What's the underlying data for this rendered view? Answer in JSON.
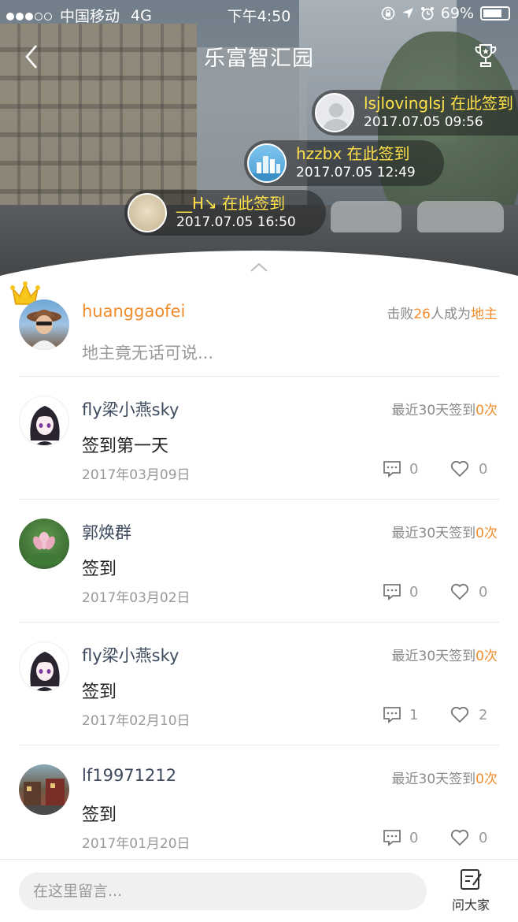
{
  "status_bar": {
    "carrier": "中国移动",
    "network": "4G",
    "time": "下午4:50",
    "battery": "69%"
  },
  "nav": {
    "title": "乐富智汇园"
  },
  "checkins": [
    {
      "who": "lsjlovinglsj 在此签到",
      "when": "2017.07.05  09:56"
    },
    {
      "who": "hzzbx 在此签到",
      "when": "2017.07.05  12:49"
    },
    {
      "who": "__H↘ 在此签到",
      "when": "2017.07.05  16:50"
    }
  ],
  "landlord": {
    "name": "huanggaofei",
    "beat_prefix": "击败",
    "beat_count": "26",
    "beat_mid": "人成为",
    "beat_title": "地主",
    "motto": "地主竟无话可说..."
  },
  "posts": [
    {
      "name": "fly梁小燕sky",
      "stat_prefix": "最近30天签到",
      "stat_count": "0次",
      "message": "签到第一天",
      "date": "2017年03月09日",
      "comments": "0",
      "likes": "0"
    },
    {
      "name": "郭焕群",
      "stat_prefix": "最近30天签到",
      "stat_count": "0次",
      "message": "签到",
      "date": "2017年03月02日",
      "comments": "0",
      "likes": "0"
    },
    {
      "name": "fly梁小燕sky",
      "stat_prefix": "最近30天签到",
      "stat_count": "0次",
      "message": "签到",
      "date": "2017年02月10日",
      "comments": "1",
      "likes": "2"
    },
    {
      "name": "lf19971212",
      "stat_prefix": "最近30天签到",
      "stat_count": "0次",
      "message": "签到",
      "date": "2017年01月20日",
      "comments": "0",
      "likes": "0"
    }
  ],
  "footer": {
    "input_placeholder": "在这里留言...",
    "ask_label": "问大家"
  },
  "colors": {
    "accent": "#f08d2a",
    "name_blue": "#3d4a5e",
    "bubble_name": "#ffe14a"
  }
}
